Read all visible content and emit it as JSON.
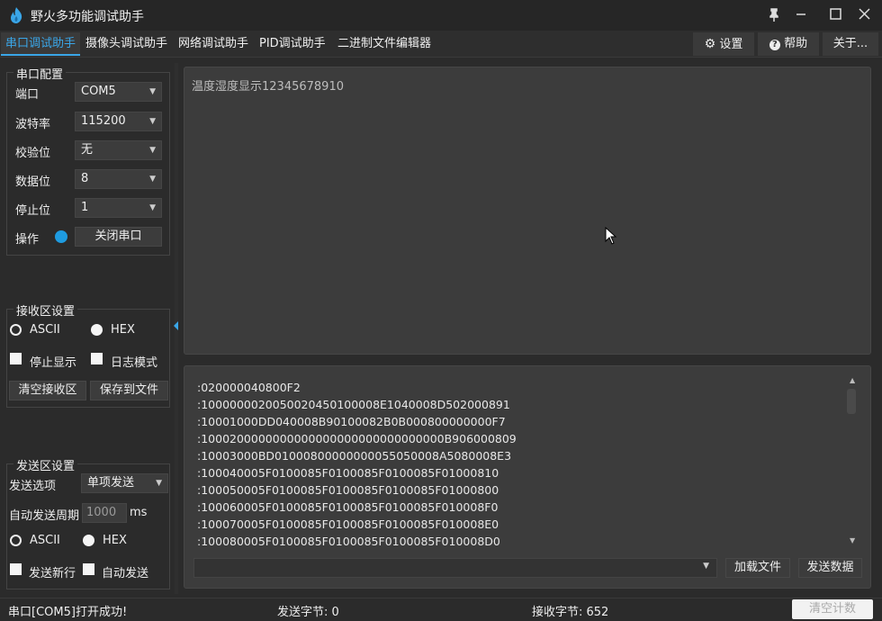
{
  "app": {
    "title": "野火多功能调试助手"
  },
  "tabs": [
    {
      "label": "串口调试助手",
      "active": true
    },
    {
      "label": "摄像头调试助手"
    },
    {
      "label": "网络调试助手"
    },
    {
      "label": "PID调试助手"
    },
    {
      "label": "二进制文件编辑器"
    }
  ],
  "toolbar": {
    "settings_label": "设置",
    "help_label": "帮助",
    "about_label": "关于..."
  },
  "serial_config": {
    "title": "串口配置",
    "port_label": "端口",
    "port_value": "COM5",
    "baud_label": "波特率",
    "baud_value": "115200",
    "parity_label": "校验位",
    "parity_value": "无",
    "databits_label": "数据位",
    "databits_value": "8",
    "stopbits_label": "停止位",
    "stopbits_value": "1",
    "operation_label": "操作",
    "close_port_label": "关闭串口",
    "status_color": "#1e9be0"
  },
  "receive_settings": {
    "title": "接收区设置",
    "ascii_label": "ASCII",
    "hex_label": "HEX",
    "selected": "HEX",
    "stop_display_label": "停止显示",
    "log_mode_label": "日志模式",
    "clear_label": "清空接收区",
    "save_label": "保存到文件"
  },
  "send_settings": {
    "title": "发送区设置",
    "option_label": "发送选项",
    "option_value": "单项发送",
    "period_label": "自动发送周期",
    "period_value": "1000",
    "period_unit": "ms",
    "ascii_label": "ASCII",
    "hex_label": "HEX",
    "selected": "HEX",
    "newline_label": "发送新行",
    "auto_send_label": "自动发送"
  },
  "receive_area": {
    "text": "温度湿度显示12345678910"
  },
  "send_area": {
    "lines": [
      ":020000040800F2",
      ":1000000020050020450100008E1040008D502000891",
      ":10001000DD040008B90100082B0B000800000000F7",
      ":1000200000000000000000000000000000B906000809",
      ":10003000BD01000800000000055050008A5080008E3",
      ":100040005F0100085F0100085F0100085F01000810",
      ":100050005F0100085F0100085F0100085F01000800",
      ":100060005F0100085F0100085F0100085F010008F0",
      ":100070005F0100085F0100085F0100085F010008E0",
      ":100080005F0100085F0100085F0100085F010008D0"
    ],
    "load_file_label": "加载文件",
    "send_data_label": "发送数据"
  },
  "status_bar": {
    "message": "串口[COM5]打开成功!",
    "sent_bytes": "发送字节: 0",
    "received_bytes": "接收字节: 652",
    "clear_count_label": "清空计数"
  },
  "colors": {
    "accent": "#3aa6e8",
    "background": "#2b2b2b",
    "panel": "#3c3c3c"
  }
}
